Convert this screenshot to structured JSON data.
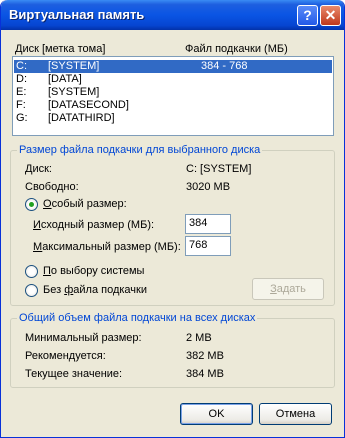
{
  "window": {
    "title": "Виртуальная память",
    "help_label": "?",
    "close_label": "✕"
  },
  "list": {
    "col_disk": "Диск [метка тома]",
    "col_pagefile": "Файл подкачки (МБ)",
    "rows": [
      {
        "drive": "C:",
        "label": "[SYSTEM]",
        "pagefile": "384 - 768",
        "selected": true
      },
      {
        "drive": "D:",
        "label": "[DATA]",
        "pagefile": ""
      },
      {
        "drive": "E:",
        "label": "[SYSTEM]",
        "pagefile": ""
      },
      {
        "drive": "F:",
        "label": "[DATASECOND]",
        "pagefile": ""
      },
      {
        "drive": "G:",
        "label": "[DATATHIRD]",
        "pagefile": ""
      }
    ]
  },
  "size_group": {
    "title": "Размер файла подкачки для выбранного диска",
    "disk_label": "Диск:",
    "disk_value": "C:  [SYSTEM]",
    "free_label": "Свободно:",
    "free_value": "3020 MB",
    "custom_pre": "",
    "custom_u": "О",
    "custom_post": "собый размер:",
    "initial_u": "И",
    "initial_post": "сходный размер (МБ):",
    "initial_value": "384",
    "max_u": "М",
    "max_post": "аксимальный размер (МБ):",
    "max_value": "768",
    "system_pre": "",
    "system_u": "П",
    "system_post": "о выбору системы",
    "none_pre": "Без ",
    "none_u": "ф",
    "none_post": "айла подкачки",
    "set_u": "З",
    "set_post": "адать"
  },
  "total_group": {
    "title": "Общий объем файла подкачки на всех дисках",
    "min_label": "Минимальный размер:",
    "min_value": "2 MB",
    "rec_label": "Рекомендуется:",
    "rec_value": "382 MB",
    "cur_label": "Текущее значение:",
    "cur_value": "384 MB"
  },
  "buttons": {
    "ok": "OK",
    "cancel": "Отмена"
  }
}
